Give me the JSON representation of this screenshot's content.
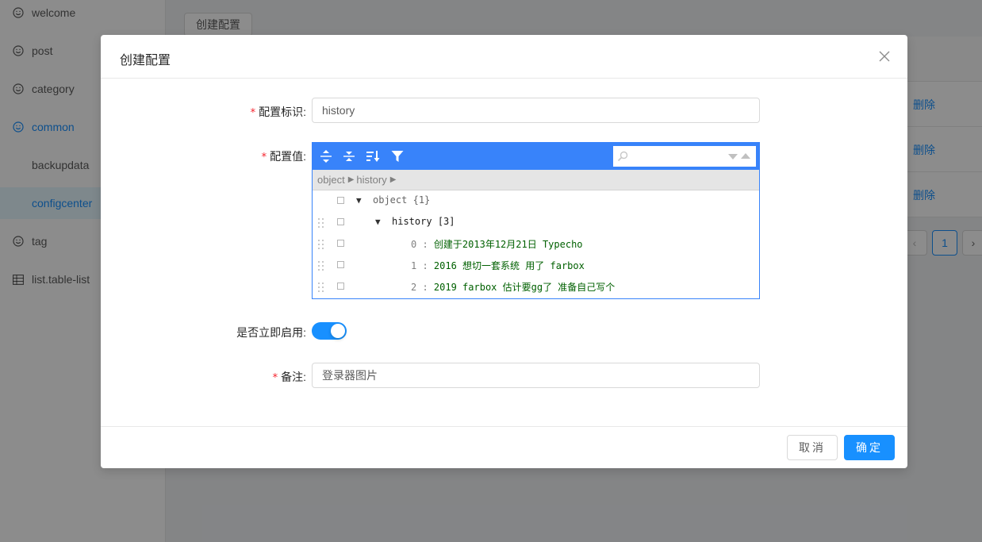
{
  "sidebar": {
    "items": [
      {
        "label": "welcome",
        "icon": "smile-icon"
      },
      {
        "label": "post",
        "icon": "smile-icon"
      },
      {
        "label": "category",
        "icon": "smile-icon"
      },
      {
        "label": "common",
        "icon": "smile-icon"
      },
      {
        "label": "backupdata",
        "icon": ""
      },
      {
        "label": "configcenter",
        "icon": ""
      },
      {
        "label": "tag",
        "icon": "smile-icon"
      },
      {
        "label": "list.table-list",
        "icon": "table-icon"
      }
    ]
  },
  "background": {
    "create_button": "创建配置",
    "delete_label": "删除",
    "pagination": {
      "current": "1"
    }
  },
  "modal": {
    "title": "创建配置",
    "fields": {
      "key_label": "配置标识:",
      "key_value": "history",
      "value_label": "配置值:",
      "enable_label": "是否立即启用:",
      "enabled": true,
      "remark_label": "备注:",
      "remark_value": "登录器图片"
    },
    "json_editor": {
      "breadcrumb": [
        "object",
        "history"
      ],
      "root": {
        "key": "object",
        "count": "{1}"
      },
      "child": {
        "key": "history",
        "count": "[3]"
      },
      "items": [
        {
          "index": "0",
          "value": "创建于2013年12月21日 Typecho"
        },
        {
          "index": "1",
          "value": "2016 想切一套系统 用了 farbox"
        },
        {
          "index": "2",
          "value": "2019 farbox 估计要gg了 准备自己写个"
        }
      ]
    },
    "footer": {
      "cancel": "取消",
      "ok": "确定"
    }
  },
  "colors": {
    "primary": "#1890ff",
    "editor_blue": "#3883fa",
    "required": "#f5222d",
    "json_string": "#006000"
  }
}
